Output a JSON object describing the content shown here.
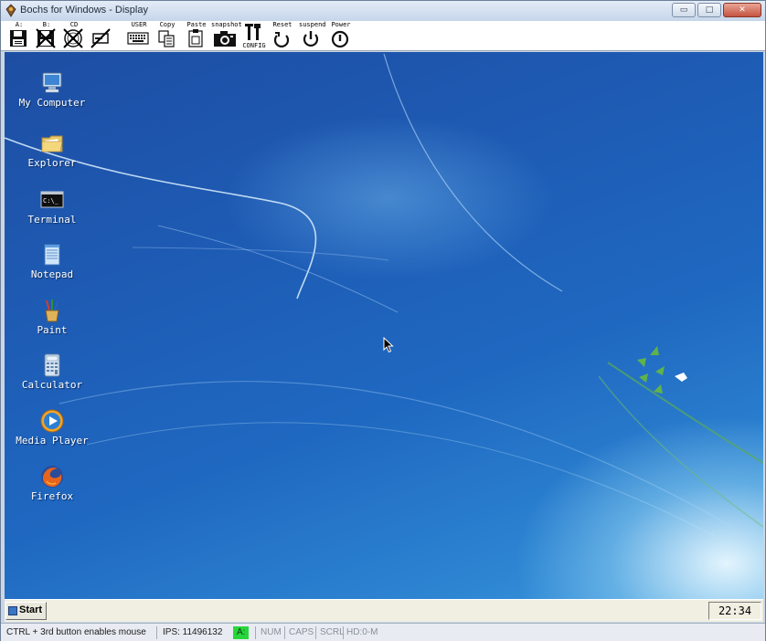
{
  "window": {
    "title": "Bochs for Windows - Display",
    "controls": {
      "minimize": "▭",
      "maximize": "□",
      "close": "✕"
    }
  },
  "toolbar": {
    "items": [
      {
        "id": "floppy-a",
        "label": "A:",
        "icon": "floppy-icon"
      },
      {
        "id": "floppy-b",
        "label": "B:",
        "icon": "floppy-disabled-icon"
      },
      {
        "id": "cdrom",
        "label": "CD",
        "icon": "cdrom-disabled-icon"
      },
      {
        "id": "cdrom2",
        "label": "",
        "icon": "drive-disabled-icon"
      },
      {
        "id": "user",
        "label": "USER",
        "icon": "keyboard-icon"
      },
      {
        "id": "copy",
        "label": "Copy",
        "icon": "copy-icon"
      },
      {
        "id": "paste",
        "label": "Paste",
        "icon": "paste-icon"
      },
      {
        "id": "snapshot",
        "label": "snapshot",
        "icon": "camera-icon"
      },
      {
        "id": "config",
        "label": "CONFIG",
        "icon": "tools-icon"
      },
      {
        "id": "reset",
        "label": "Reset",
        "icon": "reset-icon"
      },
      {
        "id": "suspend",
        "label": "suspend",
        "icon": "suspend-icon"
      },
      {
        "id": "power",
        "label": "Power",
        "icon": "power-icon"
      }
    ]
  },
  "desktop": {
    "icons": [
      {
        "label": "My Computer",
        "icon": "computer-icon"
      },
      {
        "label": "Explorer",
        "icon": "folder-icon"
      },
      {
        "label": "Terminal",
        "icon": "terminal-icon"
      },
      {
        "label": "Notepad",
        "icon": "notepad-icon"
      },
      {
        "label": "Paint",
        "icon": "paint-icon"
      },
      {
        "label": "Calculator",
        "icon": "calculator-icon"
      },
      {
        "label": "Media Player",
        "icon": "media-player-icon"
      },
      {
        "label": "Firefox",
        "icon": "firefox-icon"
      }
    ],
    "terminal_prompt": "C:\\_"
  },
  "taskbar": {
    "start_label": "Start",
    "clock": "22:34 PM"
  },
  "statusbar": {
    "hint": "CTRL + 3rd button enables mouse",
    "ips": "IPS: 11496132",
    "floppy": "A:",
    "num": "NUM",
    "caps": "CAPS",
    "scrl": "SCRL",
    "hd": "HD:0-M"
  },
  "colors": {
    "desktop_blue": "#1e5cb5",
    "floppy_active": "#27d63a",
    "taskbar": "#f0efe2"
  }
}
